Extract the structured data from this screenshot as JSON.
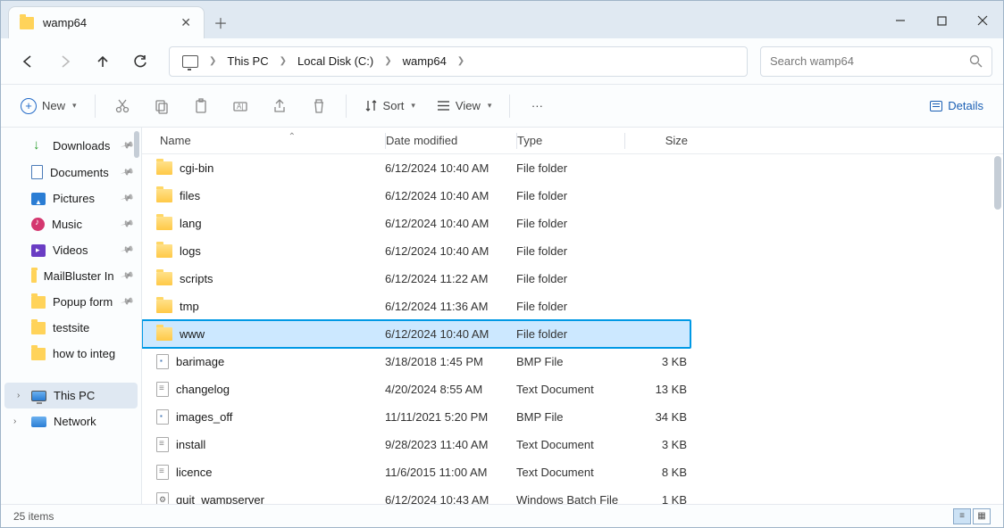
{
  "window": {
    "tab_title": "wamp64",
    "minimize": "—",
    "maximize": "▢",
    "close": "✕"
  },
  "breadcrumb": {
    "root": "This PC",
    "drive": "Local Disk (C:)",
    "folder": "wamp64"
  },
  "search": {
    "placeholder": "Search wamp64"
  },
  "toolbar": {
    "new": "New",
    "sort": "Sort",
    "view": "View",
    "details": "Details"
  },
  "sidebar": {
    "items": [
      {
        "label": "Downloads",
        "icon": "down",
        "pinned": true
      },
      {
        "label": "Documents",
        "icon": "doc",
        "pinned": true
      },
      {
        "label": "Pictures",
        "icon": "pic",
        "pinned": true
      },
      {
        "label": "Music",
        "icon": "music",
        "pinned": true
      },
      {
        "label": "Videos",
        "icon": "video",
        "pinned": true
      },
      {
        "label": "MailBluster In",
        "icon": "folder",
        "pinned": true
      },
      {
        "label": "Popup form",
        "icon": "folder",
        "pinned": true
      },
      {
        "label": "testsite",
        "icon": "folder",
        "pinned": false
      },
      {
        "label": "how to integ",
        "icon": "folder",
        "pinned": false
      }
    ],
    "thispc": "This PC",
    "network": "Network"
  },
  "columns": {
    "name": "Name",
    "date": "Date modified",
    "type": "Type",
    "size": "Size"
  },
  "files": [
    {
      "name": "cgi-bin",
      "date": "6/12/2024 10:40 AM",
      "type": "File folder",
      "size": "",
      "icon": "folder"
    },
    {
      "name": "files",
      "date": "6/12/2024 10:40 AM",
      "type": "File folder",
      "size": "",
      "icon": "folder"
    },
    {
      "name": "lang",
      "date": "6/12/2024 10:40 AM",
      "type": "File folder",
      "size": "",
      "icon": "folder"
    },
    {
      "name": "logs",
      "date": "6/12/2024 10:40 AM",
      "type": "File folder",
      "size": "",
      "icon": "folder"
    },
    {
      "name": "scripts",
      "date": "6/12/2024 11:22 AM",
      "type": "File folder",
      "size": "",
      "icon": "folder"
    },
    {
      "name": "tmp",
      "date": "6/12/2024 11:36 AM",
      "type": "File folder",
      "size": "",
      "icon": "folder"
    },
    {
      "name": "www",
      "date": "6/12/2024 10:40 AM",
      "type": "File folder",
      "size": "",
      "icon": "folder",
      "highlighted": true
    },
    {
      "name": "barimage",
      "date": "3/18/2018 1:45 PM",
      "type": "BMP File",
      "size": "3 KB",
      "icon": "bmp"
    },
    {
      "name": "changelog",
      "date": "4/20/2024 8:55 AM",
      "type": "Text Document",
      "size": "13 KB",
      "icon": "txt"
    },
    {
      "name": "images_off",
      "date": "11/11/2021 5:20 PM",
      "type": "BMP File",
      "size": "34 KB",
      "icon": "bmp"
    },
    {
      "name": "install",
      "date": "9/28/2023 11:40 AM",
      "type": "Text Document",
      "size": "3 KB",
      "icon": "txt"
    },
    {
      "name": "licence",
      "date": "11/6/2015 11:00 AM",
      "type": "Text Document",
      "size": "8 KB",
      "icon": "txt"
    },
    {
      "name": "quit_wampserver",
      "date": "6/12/2024 10:43 AM",
      "type": "Windows Batch File",
      "size": "1 KB",
      "icon": "bat"
    }
  ],
  "status": {
    "count": "25 items"
  }
}
